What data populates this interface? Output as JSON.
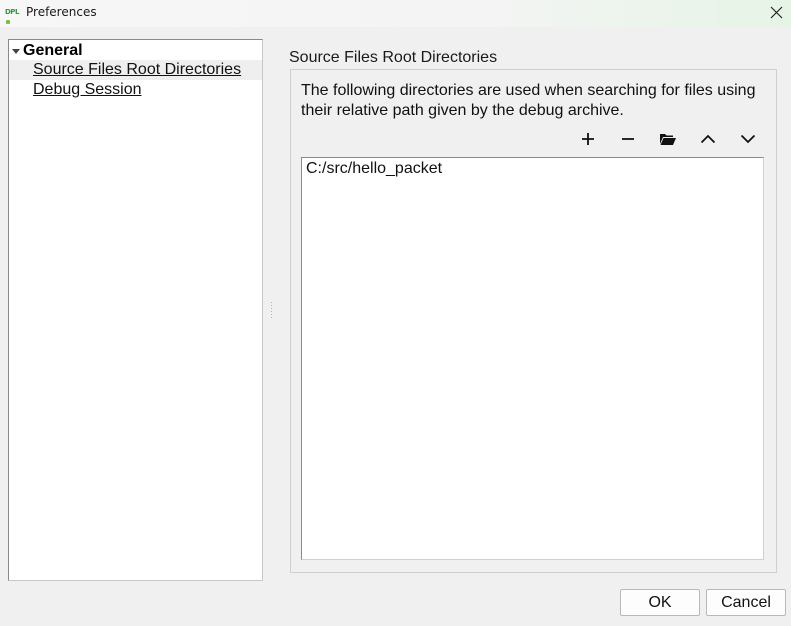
{
  "window": {
    "title": "Preferences",
    "logo_text": "DPL",
    "close_icon": "close-icon"
  },
  "tree": {
    "root_label": "General",
    "items": [
      {
        "label": "Source Files Root Directories",
        "selected": true
      },
      {
        "label": "Debug Session",
        "selected": false
      }
    ]
  },
  "panel": {
    "title": "Source Files Root Directories",
    "description": "The following directories are used when searching for files using their relative path given by the debug archive.",
    "toolbar": [
      {
        "icon": "plus-icon"
      },
      {
        "icon": "minus-icon"
      },
      {
        "icon": "folder-open-icon"
      },
      {
        "icon": "chevron-up-icon"
      },
      {
        "icon": "chevron-down-icon"
      }
    ],
    "directories": [
      "C:/src/hello_packet"
    ]
  },
  "buttons": {
    "ok_label": "OK",
    "cancel_label": "Cancel"
  },
  "colors": {
    "background": "#f0f0f0",
    "selected_item": "#efefef",
    "logo_green": "#2d9e3a"
  }
}
